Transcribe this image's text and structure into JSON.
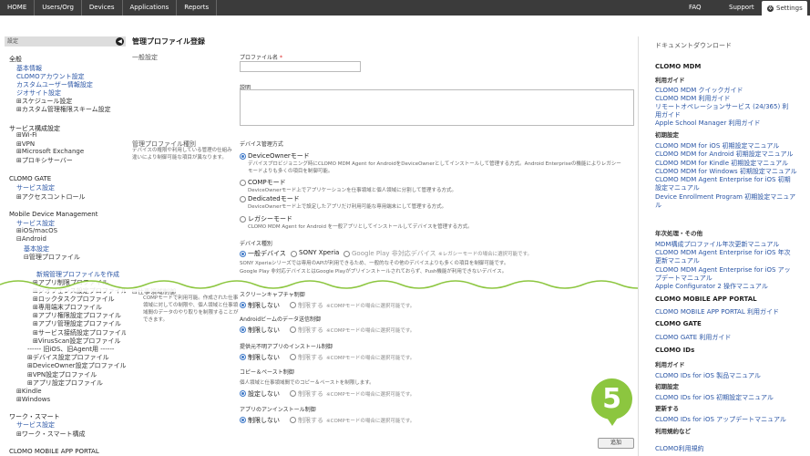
{
  "topnav": {
    "items": [
      "HOME",
      "Users/Org",
      "Devices",
      "Applications",
      "Reports"
    ],
    "faq": "FAQ",
    "support": "Support",
    "settings": "Settings"
  },
  "sidebar": {
    "header": "設定",
    "items": [
      {
        "text": "全般",
        "kind": "h"
      },
      {
        "text": "基本情報",
        "kind": "l"
      },
      {
        "text": "CLOMOアカウント設定",
        "kind": "l"
      },
      {
        "text": "カスタムユーザー情報設定",
        "kind": "l"
      },
      {
        "text": "ジオサイト設定",
        "kind": "l"
      },
      {
        "text": "⊞スケジュール設定",
        "kind": "n"
      },
      {
        "text": "⊞カスタム管理権限スキーム設定",
        "kind": "n"
      },
      {
        "text": "サービス構成設定",
        "kind": "h"
      },
      {
        "text": "⊞Wi-Fi",
        "kind": "n"
      },
      {
        "text": "⊞VPN",
        "kind": "n"
      },
      {
        "text": "⊞Microsoft Exchange",
        "kind": "n"
      },
      {
        "text": "⊞プロキシサーバー",
        "kind": "n"
      },
      {
        "text": "CLOMO GATE",
        "kind": "h"
      },
      {
        "text": "サービス設定",
        "kind": "l"
      },
      {
        "text": "⊞アクセスコントロール",
        "kind": "n"
      },
      {
        "text": "Mobile Device Management",
        "kind": "h"
      },
      {
        "text": "サービス設定",
        "kind": "l"
      },
      {
        "text": "⊞iOS/macOS",
        "kind": "n"
      },
      {
        "text": "⊟Android",
        "kind": "n"
      },
      {
        "text": "基本設定",
        "kind": "l"
      },
      {
        "text": "⊟管理プロファイル",
        "kind": "n"
      },
      {
        "text": "新規管理プロファイルを作成",
        "kind": "l"
      },
      {
        "text": "⊞アプリ制限プロファイル",
        "kind": "n"
      },
      {
        "text": "⊞ジオフェンス設定プロファイル",
        "kind": "n"
      },
      {
        "text": "⊞ロックタスクプロファイル",
        "kind": "n"
      },
      {
        "text": "⊞専用端末プロファイル",
        "kind": "n"
      },
      {
        "text": "⊞アプリ権限設定プロファイル",
        "kind": "n"
      },
      {
        "text": "⊞アプリ管理設定プロファイル",
        "kind": "n"
      },
      {
        "text": "⊞サービス接続設定プロファイル",
        "kind": "n"
      },
      {
        "text": "⊞VirusScan設定プロファイル",
        "kind": "n"
      },
      {
        "text": "------ 旧iOS、旧Agent用 ------",
        "kind": "n"
      },
      {
        "text": "⊞デバイス設定プロファイル",
        "kind": "n"
      },
      {
        "text": "⊞DeviceOwner設定プロファイル",
        "kind": "n"
      },
      {
        "text": "⊞VPN設定プロファイル",
        "kind": "n"
      },
      {
        "text": "⊞アプリ設定プロファイル",
        "kind": "n"
      },
      {
        "text": "⊞Kindle",
        "kind": "n"
      },
      {
        "text": "⊞Windows",
        "kind": "n"
      },
      {
        "text": "ワーク・スマート",
        "kind": "h"
      },
      {
        "text": "サービス設定",
        "kind": "l"
      },
      {
        "text": "⊞ワーク・スマート構成",
        "kind": "n"
      },
      {
        "text": "CLOMO MOBILE APP PORTAL",
        "kind": "h"
      }
    ]
  },
  "main": {
    "title": "管理プロファイル登録",
    "general_section": "一般設定",
    "profile_name_label": "プロファイル名",
    "required_mark": "*",
    "description_label": "説明",
    "type_section": "管理プロファイル種別",
    "type_section_desc": "デバイスの権限や利用している管理の仕組み違いにより制御可能な項目が異なります。",
    "device_mgmt_label": "デバイス管理方式",
    "mgmt_options": [
      {
        "label": "DeviceOwnerモード",
        "desc": "デバイスプロビジョニング時にCLOMO MDM Agent for AndroidをDeviceOwnerとしてインストールして管理する方式。Android Enterpriseの機能によりレガシー",
        "desc2": "モードよりも多くの項目を制御可能。",
        "selected": true
      },
      {
        "label": "COMPモード",
        "desc": "DeviceOwnerモード上でアプリケーションを仕事領域と個人領域に分割して管理する方式。",
        "selected": false
      },
      {
        "label": "Dedicatedモード",
        "desc": "DeviceOwnerモード上で設定したアプリだけ利用可能な専用端末にして管理する方式。",
        "selected": false
      },
      {
        "label": "レガシーモード",
        "desc": "CLOMO MDM Agent for Android を一般アプリとしてインストールしてデバイスを管理する方式。",
        "selected": false
      }
    ],
    "device_type_label": "デバイス種別",
    "device_types": [
      {
        "label": "一般デバイス",
        "selected": true,
        "dim": false
      },
      {
        "label": "SONY Xperia",
        "selected": false,
        "dim": false
      },
      {
        "label": "Google Play 非対応デバイス",
        "selected": false,
        "dim": true
      }
    ],
    "device_type_note": "※レガシーモードの場合に選択可能です。",
    "device_type_desc1": "SONY Xperiaシリーズでは専用のAPIが利用できるため、一般的なその他のデバイスよりも多くの項目を制御可能です。",
    "device_type_desc2": "Google Play 非対応デバイスとはGoogle Playがプリインストールされておらず、Push機能が利用できないデバイス。",
    "work_section": "⊟仕事領域制御",
    "work_section_desc": "COMPモードで利用可能。作成された仕事領域に対しての制限や、個人領域と仕事領域間のデータのやり取りを制限することができます。",
    "controls": [
      {
        "label": "スクリーンキャプチャ制御",
        "opt1": "制限しない",
        "opt2": "制限する"
      },
      {
        "label": "Androidビームのデータ送信制御",
        "opt1": "制限しない",
        "opt2": "制限する"
      },
      {
        "label": "提供元不明アプリのインストール制御",
        "opt1": "制限しない",
        "opt2": "制限する"
      },
      {
        "label": "コピー＆ペースト制御",
        "opt1": "設定しない",
        "opt2": "制限する"
      },
      {
        "label": "アプリのアンインストール制御",
        "opt1": "制限しない",
        "opt2": "制限する"
      }
    ],
    "comp_note": "※COMPモードの場合に選択可能です。",
    "copy_paste_desc": "個人領域と仕事領域間でのコピー＆ペーストを制限します。",
    "add_button": "追加",
    "step_badge": "5"
  },
  "right": {
    "title": "ドキュメントダウンロード",
    "items": [
      {
        "text": "CLOMO MDM",
        "kind": "h"
      },
      {
        "text": "利用ガイド",
        "kind": "sh"
      },
      {
        "text": "CLOMO MDM クイックガイド",
        "kind": "l"
      },
      {
        "text": "CLOMO MDM 利用ガイド",
        "kind": "l"
      },
      {
        "text": "リモートオペレーションサービス (24/365) 利",
        "kind": "l"
      },
      {
        "text": "用ガイド",
        "kind": "l"
      },
      {
        "text": "Apple School Manager 利用ガイド",
        "kind": "l"
      },
      {
        "text": "初期設定",
        "kind": "sh"
      },
      {
        "text": "CLOMO MDM for iOS 初期設定マニュアル",
        "kind": "l"
      },
      {
        "text": "CLOMO MDM for Android 初期設定マニュアル",
        "kind": "l"
      },
      {
        "text": "CLOMO MDM for Kindle 初期設定マニュアル",
        "kind": "l"
      },
      {
        "text": "CLOMO MDM for Windows 初期設定マニュアル",
        "kind": "l"
      },
      {
        "text": "CLOMO MDM Agent Enterprise for iOS 初期",
        "kind": "l"
      },
      {
        "text": "設定マニュアル",
        "kind": "l"
      },
      {
        "text": "Device Enrollment Program 初期設定マニュア",
        "kind": "l"
      },
      {
        "text": "ル",
        "kind": "l"
      },
      {
        "text": "年次処理・その他",
        "kind": "sh"
      },
      {
        "text": "MDM構成プロファイル年次更新マニュアル",
        "kind": "l"
      },
      {
        "text": "CLOMO MDM Agent Enterprise for iOS 年次",
        "kind": "l"
      },
      {
        "text": "更新マニュアル",
        "kind": "l"
      },
      {
        "text": "CLOMO MDM Agent Enterprise for iOS アッ",
        "kind": "l"
      },
      {
        "text": "プデートマニュアル",
        "kind": "l"
      },
      {
        "text": "Apple Configurator 2 操作マニュアル",
        "kind": "l"
      },
      {
        "text": "CLOMO MOBILE APP PORTAL",
        "kind": "h"
      },
      {
        "text": "CLOMO MOBILE APP PORTAL 利用ガイド",
        "kind": "l"
      },
      {
        "text": "CLOMO GATE",
        "kind": "h"
      },
      {
        "text": "CLOMO GATE 利用ガイド",
        "kind": "l"
      },
      {
        "text": "CLOMO IDs",
        "kind": "h"
      },
      {
        "text": "利用ガイド",
        "kind": "sh"
      },
      {
        "text": "CLOMO IDs for iOS 製品マニュアル",
        "kind": "l"
      },
      {
        "text": "初期設定",
        "kind": "sh"
      },
      {
        "text": "CLOMO IDs for iOS 初期設定マニュアル",
        "kind": "l"
      },
      {
        "text": "更新する",
        "kind": "sh"
      },
      {
        "text": "CLOMO IDs for iOS アップデートマニュアル",
        "kind": "l"
      },
      {
        "text": "利用規約など",
        "kind": "sh"
      },
      {
        "text": "CLOMO利用規約",
        "kind": "l"
      }
    ]
  },
  "colors": {
    "link": "#2a55a5",
    "badge": "#8cc63f",
    "nav": "#3b3b3b",
    "radio_on": "#3e79c8"
  }
}
